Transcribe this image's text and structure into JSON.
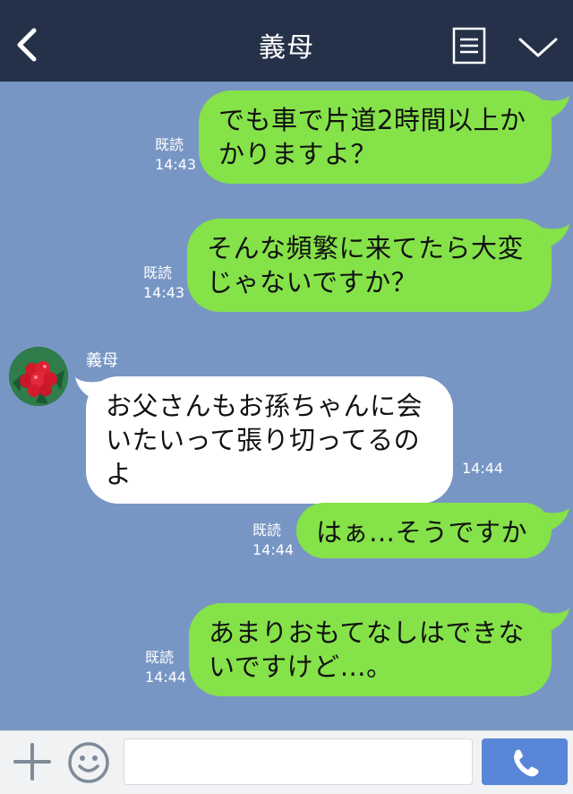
{
  "header": {
    "title": "義母",
    "icons": {
      "back": "chevron-left-icon",
      "menu": "menu-list-icon",
      "collapse": "chevron-down-icon"
    }
  },
  "colors": {
    "header_bg": "#243149",
    "chat_bg": "#7896c4",
    "outgoing_bubble": "#85e249",
    "incoming_bubble": "#ffffff",
    "send_button": "#5a86d8"
  },
  "messages": [
    {
      "direction": "out",
      "text": "でも車で片道2時間以上かかりますよ？",
      "read": "既読",
      "time": "14:43"
    },
    {
      "direction": "out",
      "text": "そんな頻繁に来てたら大変じゃないですか？",
      "read": "既読",
      "time": "14:43"
    },
    {
      "direction": "in",
      "sender": "義母",
      "text": "お父さんもお孫ちゃんに会いたいって張り切ってるのよ",
      "time": "14:44"
    },
    {
      "direction": "out",
      "text": "はぁ…そうですか",
      "read": "既読",
      "time": "14:44"
    },
    {
      "direction": "out",
      "text": "あまりおもてなしはできないですけど…。",
      "read": "既読",
      "time": "14:44"
    }
  ],
  "composer": {
    "input_value": "",
    "icons": {
      "add": "plus-icon",
      "emoji": "smiley-icon",
      "call": "phone-icon"
    }
  }
}
